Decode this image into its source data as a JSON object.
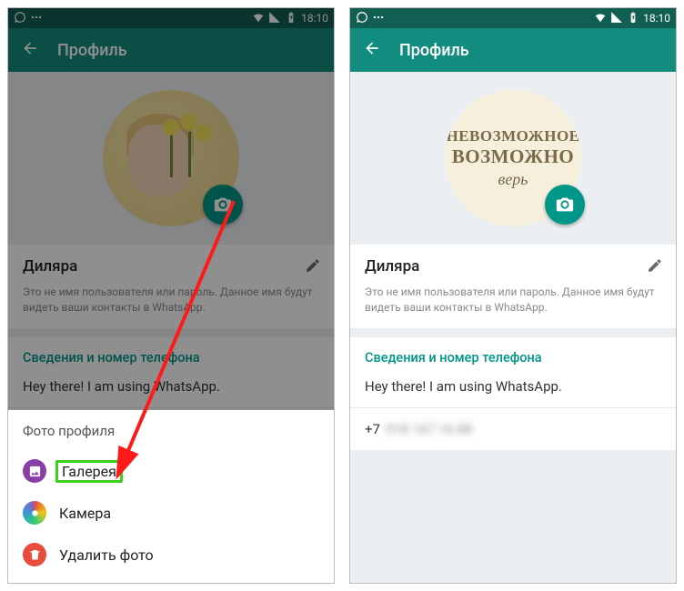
{
  "status": {
    "time": "18:10"
  },
  "appbar": {
    "title": "Профиль"
  },
  "profile": {
    "name": "Диляра",
    "hint": "Это не имя пользователя или пароль. Данное имя будут видеть ваши контакты в WhatsApp.",
    "section_title": "Сведения и номер телефона",
    "status_msg": "Hey there! I am using WhatsApp.",
    "phone_prefix": "+7",
    "phone_masked": "918 167 16 88"
  },
  "avatar2": {
    "line1": "НЕВОЗМОЖНОЕ",
    "line2": "ВОЗМОЖНО",
    "line3": "верь"
  },
  "sheet": {
    "title": "Фото профиля",
    "gallery": "Галерея",
    "camera": "Камера",
    "delete": "Удалить фото"
  }
}
